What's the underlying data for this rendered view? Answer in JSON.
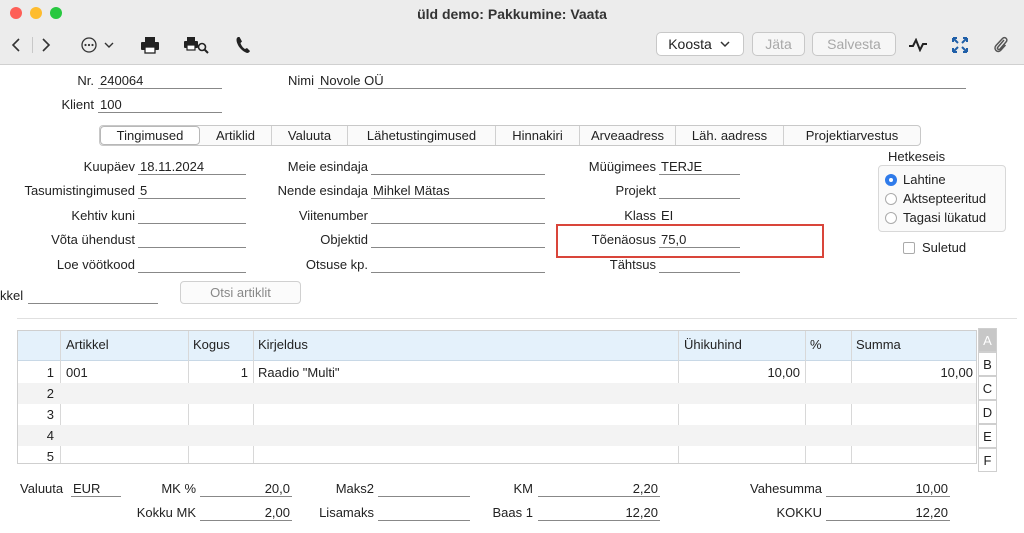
{
  "window": {
    "title": "üld demo: Pakkumine: Vaata"
  },
  "toolbar": {
    "koosta_label": "Koosta",
    "jata_label": "Jäta",
    "salvesta_label": "Salvesta"
  },
  "header": {
    "nr_label": "Nr.",
    "nr_value": "240064",
    "nimi_label": "Nimi",
    "nimi_value": "Novole OÜ",
    "klient_label": "Klient",
    "klient_value": "100"
  },
  "tabs": [
    "Tingimused",
    "Artiklid",
    "Valuuta",
    "Lähetustingimused",
    "Hinnakiri",
    "Arveaadress",
    "Läh. aadress",
    "Projektiarvestus"
  ],
  "form": {
    "kuupaev_label": "Kuupäev",
    "kuupaev_value": "18.11.2024",
    "tasumistingimused_label": "Tasumistingimused",
    "tasumistingimused_value": "5",
    "kehtiv_label": "Kehtiv kuni",
    "kehtiv_value": "",
    "vota_label": "Võta ühendust",
    "vota_value": "",
    "loe_label": "Loe vöötkood",
    "loe_value": "",
    "meie_label": "Meie esindaja",
    "meie_value": "",
    "nende_label": "Nende esindaja",
    "nende_value": "Mihkel Mätas",
    "viitenumber_label": "Viitenumber",
    "viitenumber_value": "",
    "objektid_label": "Objektid",
    "objektid_value": "",
    "otsuse_label": "Otsuse kp.",
    "otsuse_value": "",
    "muugimees_label": "Müügimees",
    "muugimees_value": "TERJE",
    "projekt_label": "Projekt",
    "projekt_value": "",
    "klass_label": "Klass",
    "klass_value": "EI",
    "toenaosus_label": "Tõenäosus",
    "toenaosus_value": "75,0",
    "tahtsus_label": "Tähtsus",
    "tahtsus_value": "",
    "artikkel_label": "kkel",
    "artikkel_value": "",
    "otsi_label": "Otsi artiklit"
  },
  "status": {
    "title": "Hetkeseis",
    "options": [
      "Lahtine",
      "Aktsepteeritud",
      "Tagasi lükatud"
    ],
    "selected": 0,
    "suletud_label": "Suletud"
  },
  "grid": {
    "columns": [
      "Artikkel",
      "Kogus",
      "Kirjeldus",
      "Ühikuhind",
      "%",
      "Summa"
    ],
    "rows": [
      {
        "n": "1",
        "artikkel": "001",
        "kogus": "1",
        "kirjeldus": "Raadio \"Multi\"",
        "uhikuhind": "10,00",
        "pct": "",
        "summa": "10,00"
      },
      {
        "n": "2",
        "artikkel": "",
        "kogus": "",
        "kirjeldus": "",
        "uhikuhind": "",
        "pct": "",
        "summa": ""
      },
      {
        "n": "3",
        "artikkel": "",
        "kogus": "",
        "kirjeldus": "",
        "uhikuhind": "",
        "pct": "",
        "summa": ""
      },
      {
        "n": "4",
        "artikkel": "",
        "kogus": "",
        "kirjeldus": "",
        "uhikuhind": "",
        "pct": "",
        "summa": ""
      },
      {
        "n": "5",
        "artikkel": "",
        "kogus": "",
        "kirjeldus": "",
        "uhikuhind": "",
        "pct": "",
        "summa": ""
      }
    ],
    "side_tabs": [
      "A",
      "B",
      "C",
      "D",
      "E",
      "F"
    ]
  },
  "totals": {
    "valuuta_label": "Valuuta",
    "valuuta_value": "EUR",
    "mk_label": "MK %",
    "mk_value": "20,0",
    "kokku_mk_label": "Kokku MK",
    "kokku_mk_value": "2,00",
    "maks2_label": "Maks2",
    "maks2_value": "",
    "lisamaks_label": "Lisamaks",
    "lisamaks_value": "",
    "km_label": "KM",
    "km_value": "2,20",
    "baas1_label": "Baas 1",
    "baas1_value": "12,20",
    "vahesumma_label": "Vahesumma",
    "vahesumma_value": "10,00",
    "kokku_label": "KOKKU",
    "kokku_value": "12,20"
  }
}
